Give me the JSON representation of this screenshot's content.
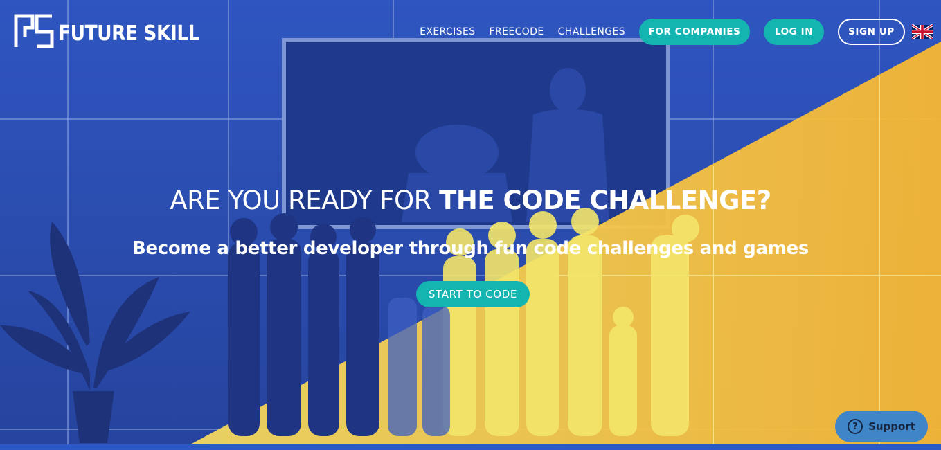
{
  "brand": {
    "name": "FUTURE SKILL",
    "logo_icon": "future-skill-logo"
  },
  "nav": {
    "links": [
      "EXERCISES",
      "FREECODE",
      "CHALLENGES"
    ],
    "for_companies": "FOR COMPANIES",
    "login": "LOG IN",
    "signup": "SIGN UP",
    "language_flag_icon": "uk-flag-icon"
  },
  "hero": {
    "headline_light": "ARE YOU READY FOR ",
    "headline_bold": "THE CODE CHALLENGE?",
    "subheadline": "Become a better developer through fun code challenges and games",
    "cta": "START TO CODE"
  },
  "support": {
    "label": "Support",
    "icon": "question-icon"
  },
  "colors": {
    "accent": "#14b5b0",
    "background_blue": "#2a4bb0",
    "highlight_yellow": "#f5c542",
    "support_blue": "#3f86c8"
  }
}
